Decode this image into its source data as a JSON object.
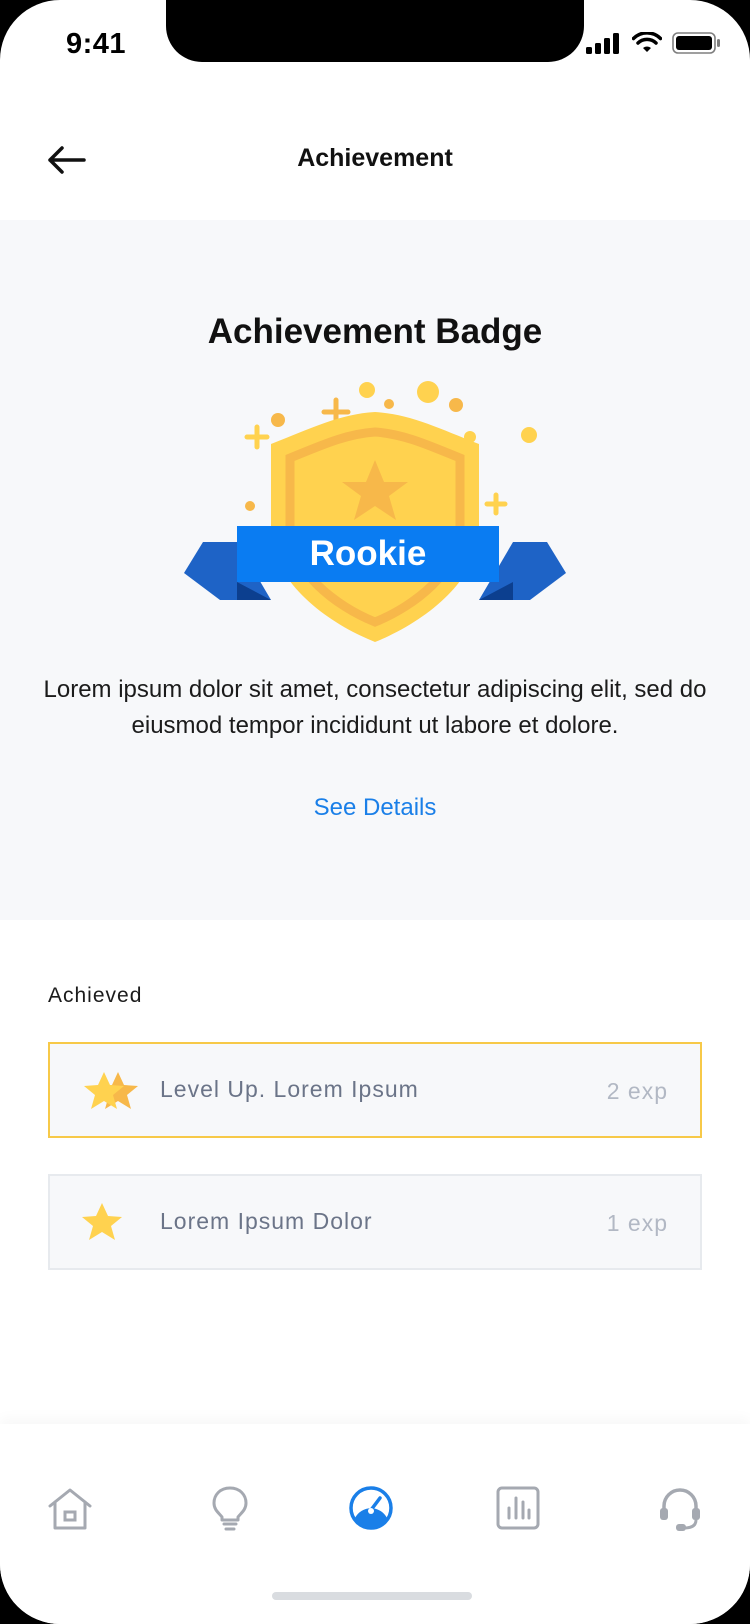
{
  "status_bar": {
    "time": "9:41"
  },
  "header": {
    "title": "Achievement"
  },
  "hero": {
    "title": "Achievement Badge",
    "badge_label": "Rookie",
    "description": "Lorem ipsum dolor sit amet, consectetur adipiscing elit, sed do eiusmod tempor incididunt ut labore et dolore.",
    "link": "See Details"
  },
  "achieved": {
    "label": "Achieved",
    "items": [
      {
        "name": "Level Up. Lorem Ipsum",
        "exp": "2 exp",
        "icon": "double-star-icon"
      },
      {
        "name": "Lorem Ipsum Dolor",
        "exp": "1 exp",
        "icon": "star-icon"
      }
    ]
  },
  "tabbar": {
    "items": [
      "home-icon",
      "lightbulb-icon",
      "speedometer-icon",
      "bar-chart-icon",
      "headset-icon"
    ],
    "active": "speedometer-icon"
  },
  "colors": {
    "accent": "#1a7fe8",
    "badge_ribbon": "#0a7cf2",
    "badge_gold": "#ffd24f",
    "highlight_border": "#f7c948",
    "icon_gray": "#a5a9b1"
  }
}
